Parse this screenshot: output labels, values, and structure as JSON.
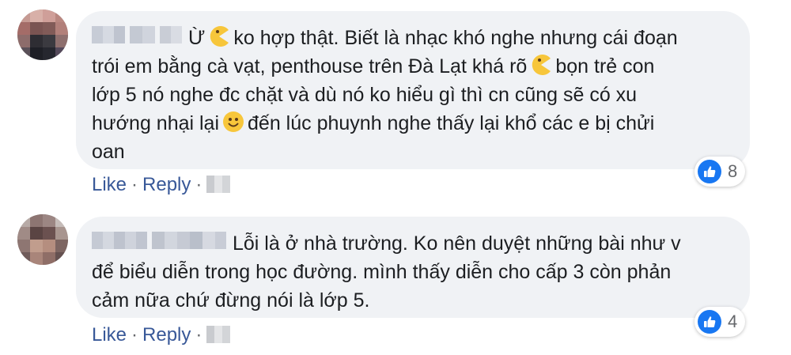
{
  "comments": [
    {
      "lines": [
        "Ừ",
        "ko hợp thật. Biết là nhạc khó nghe nhưng cái đoạn",
        "trói em bằng cà vạt, penthouse trên Đà Lạt khá rõ",
        "bọn trẻ con",
        "lớp 5 nó nghe đc chặt và dù nó ko hiểu gì thì cn cũng sẽ có xu",
        "hướng nhại lại",
        "đến lúc phuynh nghe thấy lại khổ các e bị chửi",
        "oan"
      ],
      "like_label": "Like",
      "reply_label": "Reply",
      "separator": "·",
      "reaction_count": "8"
    },
    {
      "lines": [
        "Lỗi là ở nhà trường. Ko nên duyệt những bài như v",
        "để biểu diễn trong học đường. mình thấy diễn cho cấp 3 còn phản",
        "cảm nữa chứ đừng nói là lớp 5."
      ],
      "like_label": "Like",
      "reply_label": "Reply",
      "separator": "·",
      "reaction_count": "4"
    }
  ],
  "icons": {
    "emoji_pacman": "pacman-emoji-icon",
    "emoji_smile": "smile-emoji-icon",
    "reaction": "like-thumb-icon"
  },
  "colors": {
    "bubble": "#f0f2f5",
    "link": "#385898",
    "like_blue": "#1877f2",
    "emoji_yellow": "#f7c63b"
  }
}
